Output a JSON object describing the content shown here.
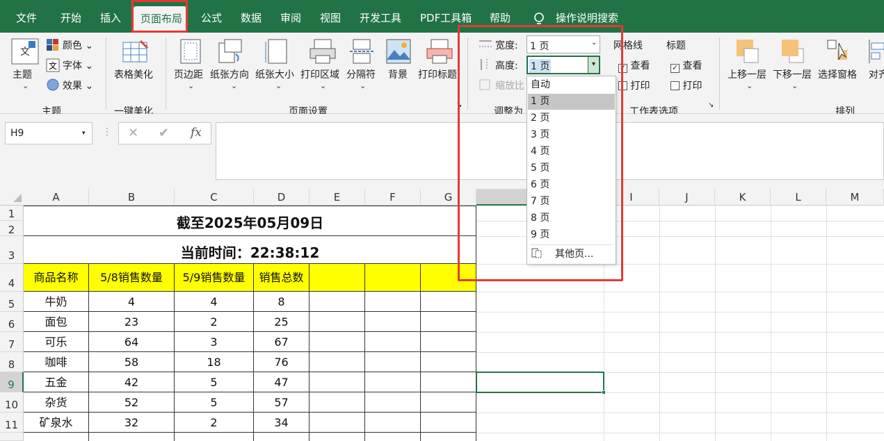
{
  "tabs": [
    "文件",
    "开始",
    "插入",
    "页面布局",
    "公式",
    "数据",
    "审阅",
    "视图",
    "开发工具",
    "PDF工具箱",
    "帮助"
  ],
  "tell_me": "操作说明搜索",
  "ribbon": {
    "theme": {
      "themes": "主题",
      "colors": "颜色",
      "fonts": "字体",
      "effects": "效果",
      "group": "主题"
    },
    "beautify": {
      "btn": "表格美化",
      "group": "一键美化"
    },
    "page_setup": {
      "margins": "页边距",
      "orientation": "纸张方向",
      "size": "纸张大小",
      "print_area": "打印区域",
      "breaks": "分隔符",
      "background": "背景",
      "print_titles": "打印标题",
      "group": "页面设置"
    },
    "scale": {
      "width_label": "宽度:",
      "width_value": "1 页",
      "height_label": "高度:",
      "height_value": "1 页",
      "scale_label": "缩放比",
      "group": "调整为"
    },
    "sheet_options": {
      "gridlines": "网格线",
      "headings": "标题",
      "view": "查看",
      "print": "打印",
      "group": "工作表选项"
    },
    "arrange": {
      "bring_forward": "上移一层",
      "send_backward": "下移一层",
      "selection_pane": "选择窗格",
      "align": "对齐",
      "group": "排列"
    }
  },
  "namebox": "H9",
  "fx": "fx",
  "columns": [
    "A",
    "B",
    "C",
    "D",
    "E",
    "F",
    "G",
    "H",
    "I",
    "J",
    "K",
    "L",
    "M"
  ],
  "rows": [
    "1",
    "2",
    "3",
    "4",
    "5",
    "6",
    "7",
    "8",
    "9",
    "10",
    "11"
  ],
  "sheet": {
    "title1": "截至2025年05月09日",
    "title2": "当前时间：22:38:12",
    "headers": [
      "商品名称",
      "5/8销售数量",
      "5/9销售数量",
      "销售总数"
    ],
    "data": [
      [
        "牛奶",
        "4",
        "4",
        "8"
      ],
      [
        "面包",
        "23",
        "2",
        "25"
      ],
      [
        "可乐",
        "64",
        "3",
        "67"
      ],
      [
        "咖啡",
        "58",
        "18",
        "76"
      ],
      [
        "五金",
        "42",
        "5",
        "47"
      ],
      [
        "杂货",
        "52",
        "5",
        "57"
      ],
      [
        "矿泉水",
        "32",
        "2",
        "34"
      ]
    ]
  },
  "dropdown": {
    "items": [
      "自动",
      "1 页",
      "2 页",
      "3 页",
      "4 页",
      "5 页",
      "6 页",
      "7 页",
      "8 页",
      "9 页"
    ],
    "selected": "1 页",
    "more": "其他页..."
  },
  "colors": {
    "excel_green": "#217346",
    "highlight_red": "#e53a33",
    "header_yellow": "#ffff00"
  }
}
